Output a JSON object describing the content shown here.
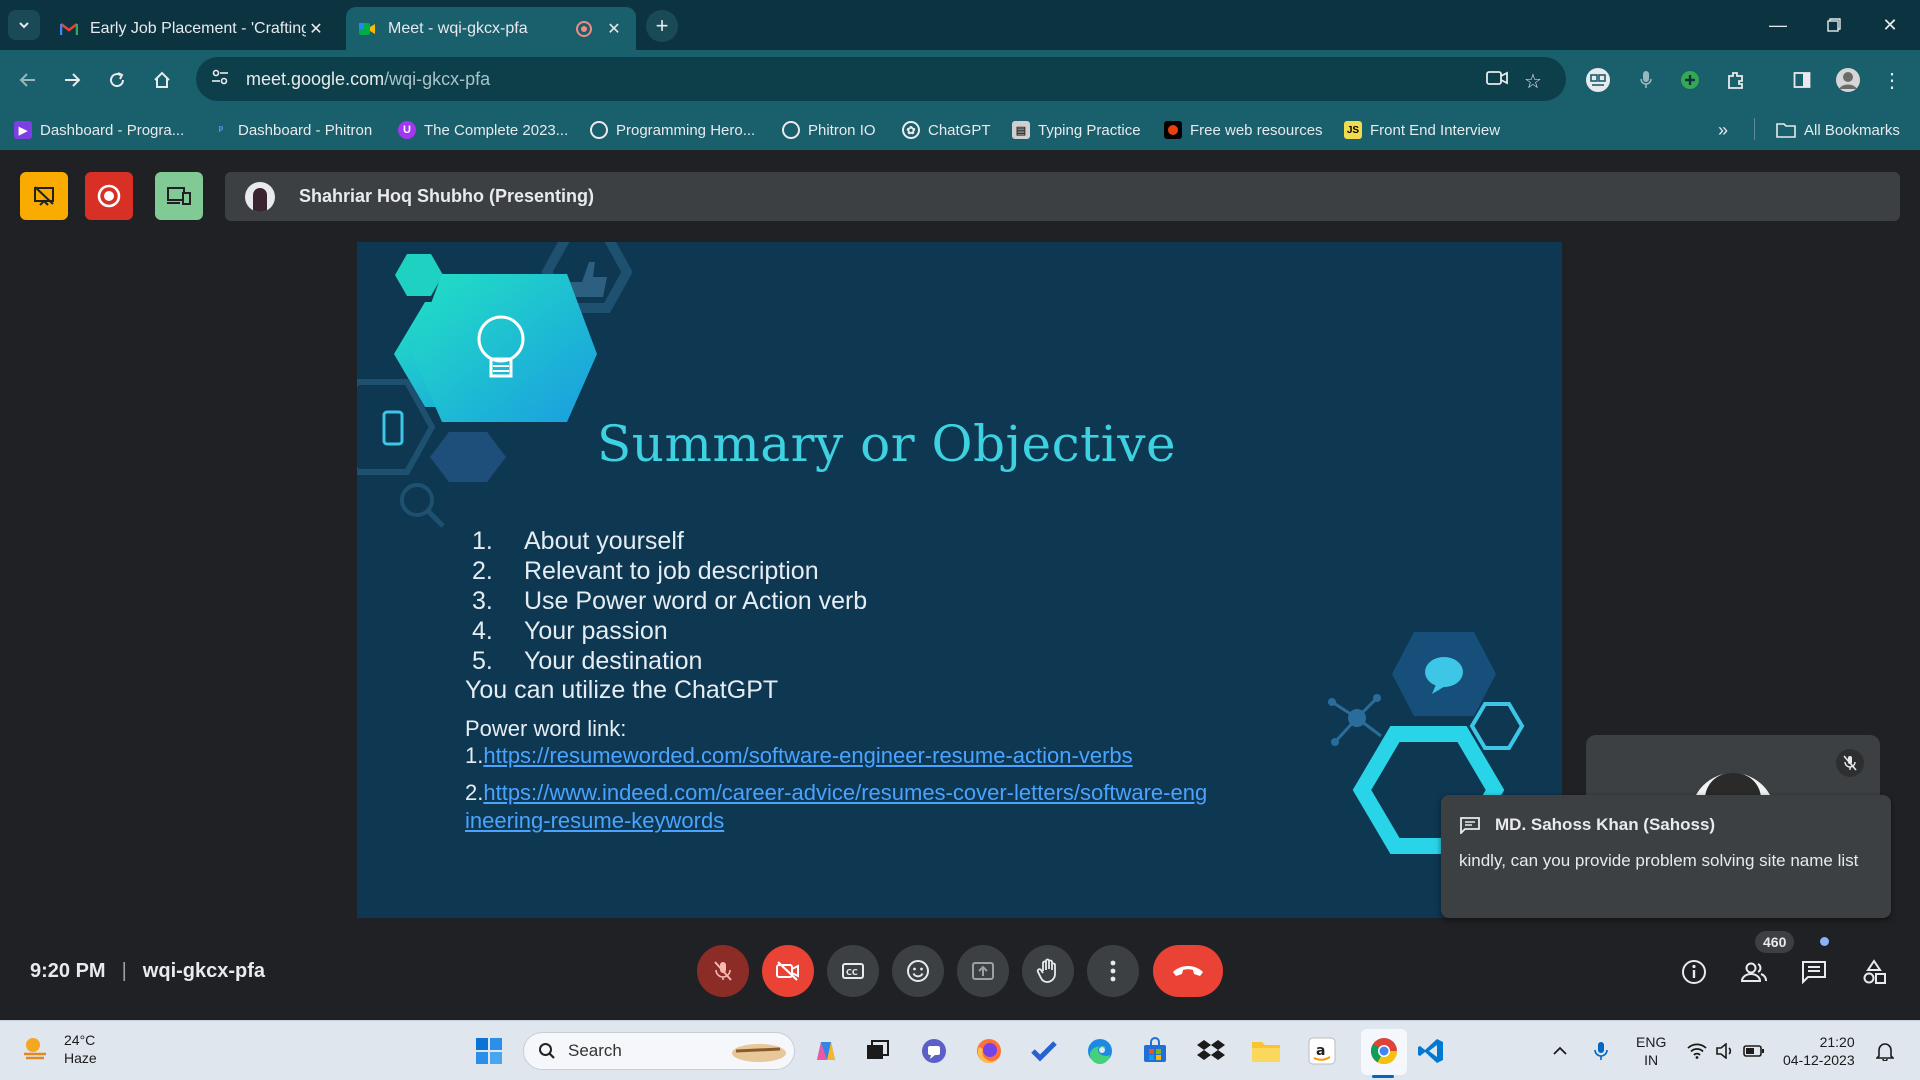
{
  "browser": {
    "tabs": [
      {
        "title": "Early Job Placement - 'Crafting",
        "active": false,
        "favicon": "gmail-icon"
      },
      {
        "title": "Meet - wqi-gkcx-pfa",
        "active": true,
        "favicon": "meet-icon",
        "recording": true
      }
    ],
    "url_host": "meet.google.com",
    "url_path": "/wqi-gkcx-pfa",
    "bookmarks": [
      {
        "label": "Dashboard - Progra...",
        "icon_color": "#7b3fe4"
      },
      {
        "label": "Dashboard - Phitron",
        "icon_color": "#1c6fb5"
      },
      {
        "label": "The Complete 2023...",
        "icon_color": "#a435f0"
      },
      {
        "label": "Programming Hero...",
        "icon_color": "#ffffff"
      },
      {
        "label": "Phitron IO",
        "icon_color": "#ffffff"
      },
      {
        "label": "ChatGPT",
        "icon_color": "#ffffff"
      },
      {
        "label": "Typing Practice",
        "icon_color": "#d0d0d0"
      },
      {
        "label": "Free web resources",
        "icon_color": "#e8400c"
      },
      {
        "label": "Front End Interview",
        "icon_color": "#f0db4f"
      }
    ],
    "all_bookmarks_label": "All Bookmarks"
  },
  "meet": {
    "presenter": "Shahriar Hoq Shubho (Presenting)",
    "time": "9:20 PM",
    "meeting_code": "wqi-gkcx-pfa",
    "participant_count": "460",
    "colors": {
      "accent_red": "#ea4335",
      "slide_bg": "#0e3752",
      "slide_title": "#3ed1e0",
      "link": "#4aa3ff"
    }
  },
  "slide": {
    "title": "Summary or Objective",
    "items": [
      {
        "num": "1.",
        "text": "About yourself"
      },
      {
        "num": "2.",
        "text": "Relevant to job description"
      },
      {
        "num": "3.",
        "text": "Use Power word or Action verb"
      },
      {
        "num": "4.",
        "text": "Your passion"
      },
      {
        "num": "5.",
        "text": "Your destination"
      }
    ],
    "chatgpt_line": "You can utilize the ChatGPT",
    "power_word_label": "Power word link:",
    "link1_prefix": "1.",
    "link1": "https://resumeworded.com/software-engineer-resume-action-verbs",
    "link2_prefix": "2.",
    "link2_line1": "https://www.indeed.com/career-advice/resumes-cover-letters/software-eng",
    "link2_line2": "ineering-resume-keywords"
  },
  "chat_toast": {
    "sender": "MD. Sahoss Khan (Sahoss)",
    "message": "kindly, can you provide problem solving site name list"
  },
  "taskbar": {
    "temperature": "24°C",
    "weather": "Haze",
    "search_placeholder": "Search",
    "lang_top": "ENG",
    "lang_bottom": "IN",
    "clock_time": "21:20",
    "clock_date": "04-12-2023"
  }
}
